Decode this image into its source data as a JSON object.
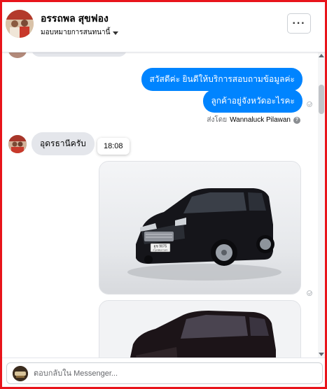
{
  "header": {
    "contact_name": "อรรถพล สุขฟอง",
    "assign_label": "มอบหมายการสนทนานี้",
    "more_label": "···"
  },
  "messages": [
    {
      "direction": "out",
      "text": "สวัสดีค่ะ  ยินดีให้บริการสอบถามข้อมูลค่ะ"
    },
    {
      "direction": "out",
      "text": "ลูกค้าอยู่จังหวัดอะไรคะ"
    },
    {
      "direction": "in",
      "text": "อุดรธานีครับ"
    }
  ],
  "sent_by": {
    "prefix": "ส่งโดย",
    "name": "Wannaluck Pilawan",
    "help": "?"
  },
  "time_tooltip": "18:08",
  "photos": [
    {
      "plate_line1": "ฐช 9075",
      "plate_line2": "กรุงเทพมหานคร"
    }
  ],
  "footer": {
    "reply_placeholder": "ตอบกลับใน Messenger..."
  },
  "colors": {
    "frame": "#e8141b",
    "outgoing_bubble": "#0084ff",
    "incoming_bubble": "#e4e6eb"
  },
  "icons": [
    "more-icon",
    "caret-down-icon",
    "seen-check-icon",
    "help-icon",
    "scroll-up-icon",
    "scroll-down-icon"
  ]
}
